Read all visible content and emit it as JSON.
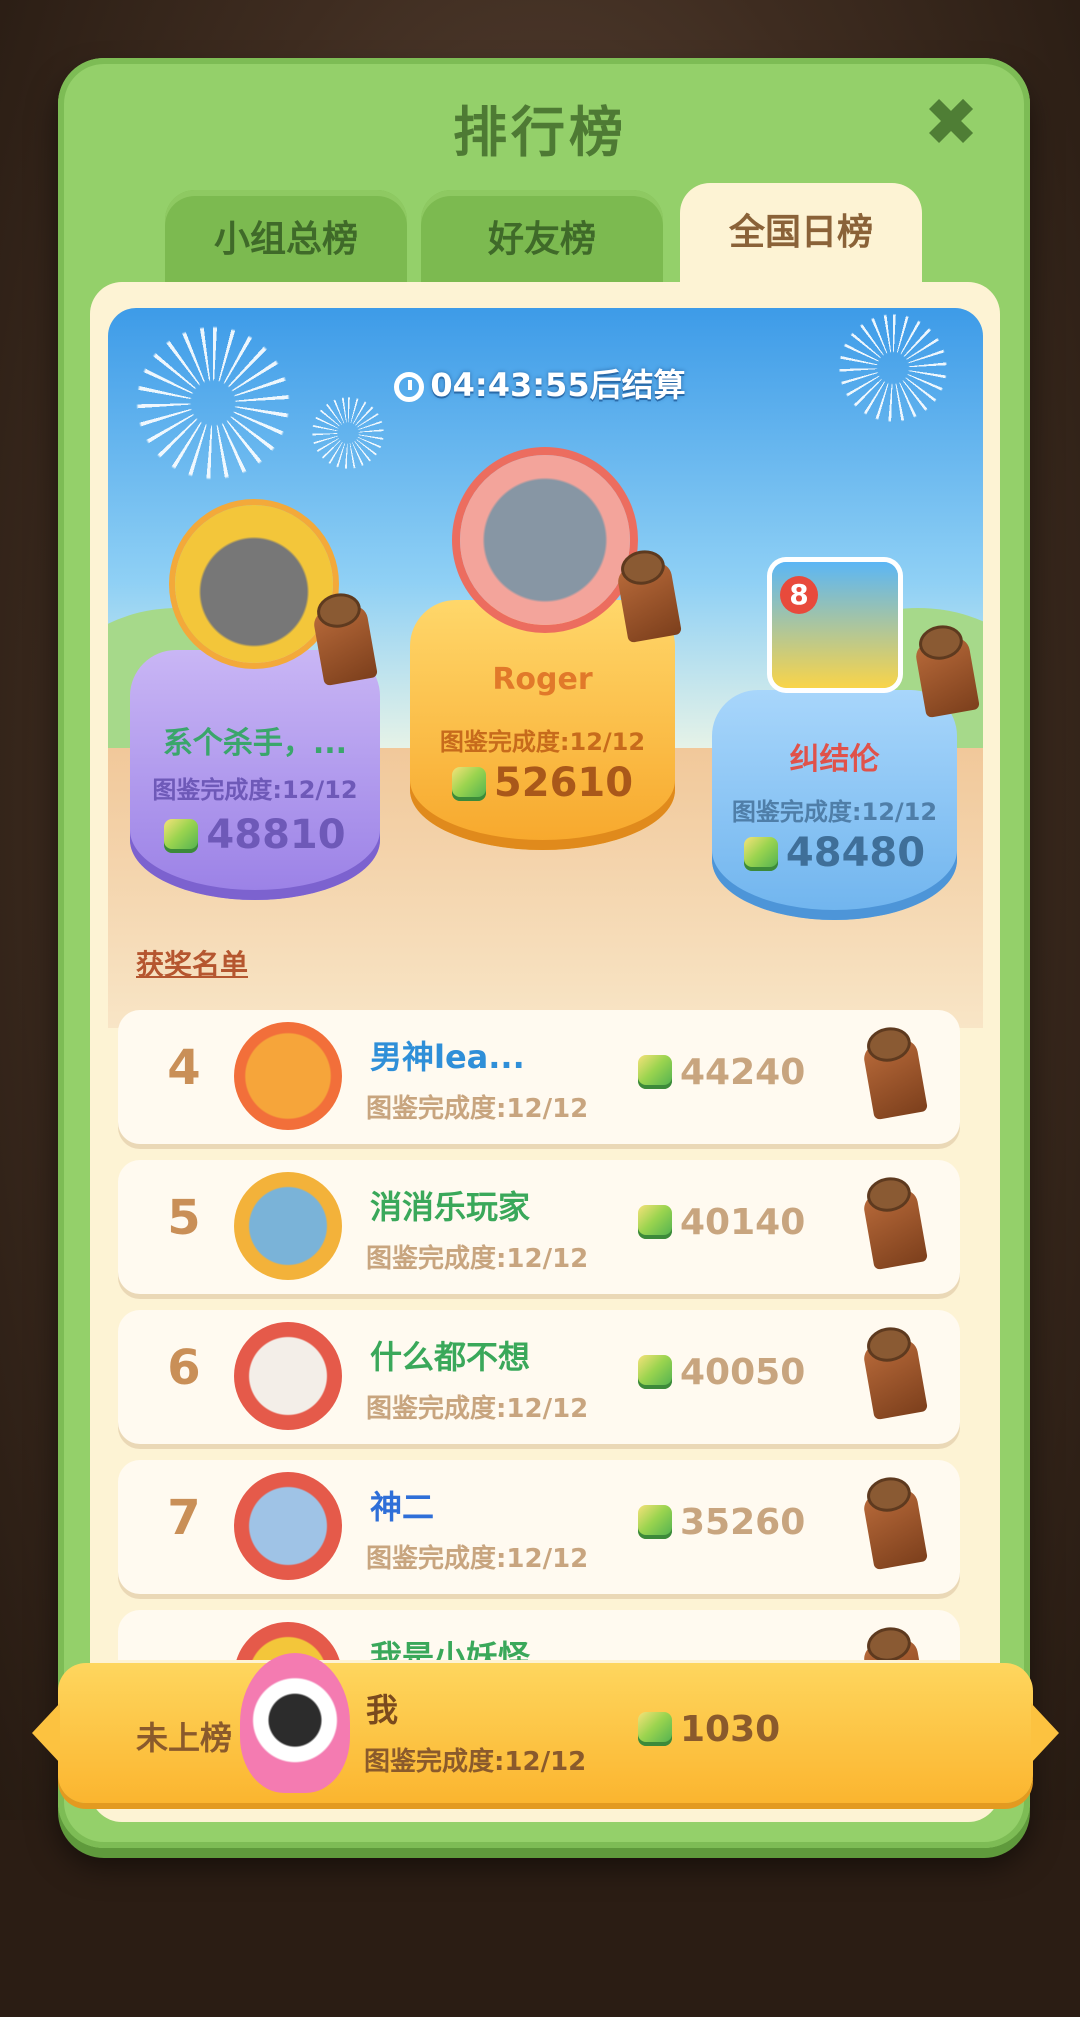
{
  "title": "排行榜",
  "close_icon": "close-icon",
  "tabs": [
    {
      "label": "小组总榜",
      "active": false
    },
    {
      "label": "好友榜",
      "active": false
    },
    {
      "label": "全国日榜",
      "active": true
    }
  ],
  "timer": "04:43:55后结算",
  "podium": {
    "first": {
      "name": "Roger",
      "progress": "图鉴完成度:12/12",
      "score": "52610"
    },
    "second": {
      "name": "系个杀手，...",
      "progress": "图鉴完成度:12/12",
      "score": "48810"
    },
    "third": {
      "name": "纠结伦",
      "progress": "图鉴完成度:12/12",
      "score": "48480",
      "badge": "8"
    }
  },
  "award_list_label": "获奖名单",
  "rows": [
    {
      "rank": "4",
      "name": "男神lea...",
      "progress": "图鉴完成度:12/12",
      "score": "44240"
    },
    {
      "rank": "5",
      "name": "消消乐玩家",
      "progress": "图鉴完成度:12/12",
      "score": "40140"
    },
    {
      "rank": "6",
      "name": "什么都不想",
      "progress": "图鉴完成度:12/12",
      "score": "40050"
    },
    {
      "rank": "7",
      "name": "神二",
      "progress": "图鉴完成度:12/12",
      "score": "35260"
    },
    {
      "rank": "",
      "name": "我是小妖怪...",
      "progress": "",
      "score": ""
    }
  ],
  "me": {
    "rank_label": "未上榜",
    "name": "我",
    "progress": "图鉴完成度:12/12",
    "score": "1030"
  },
  "colors": {
    "panel": "#94d06a",
    "tab_active": "#fdf3d4",
    "gold_row": "#fbb52f",
    "score_text": "#c8a57f"
  }
}
